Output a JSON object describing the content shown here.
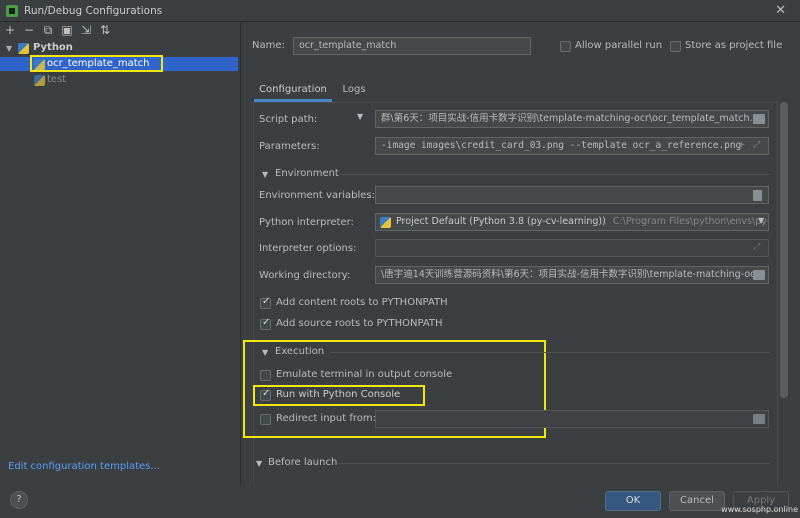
{
  "window": {
    "title": "Run/Debug Configurations"
  },
  "toolbar": {
    "icons": [
      "plus-icon",
      "minus-icon",
      "copy-icon",
      "save-icon",
      "move-icon",
      "sort-icon"
    ]
  },
  "tree": {
    "group_label": "Python",
    "items": [
      {
        "label": "ocr_template_match"
      },
      {
        "label": "test"
      }
    ]
  },
  "edit_templates_link": "Edit configuration templates...",
  "name_row": {
    "label": "Name:",
    "value": "ocr_template_match",
    "allow_parallel_label": "Allow parallel run",
    "store_project_label": "Store as project file"
  },
  "tabs": [
    "Configuration",
    "Logs"
  ],
  "config": {
    "script_path_label": "Script path:",
    "script_path_value": "群\\第6天：项目实战-信用卡数字识别\\template-matching-ocr\\ocr_template_match.py",
    "parameters_label": "Parameters:",
    "parameters_value": "-image images\\credit_card_03.png --template ocr_a_reference.png",
    "environment_section": "Environment",
    "env_vars_label": "Environment variables:",
    "env_vars_value": "",
    "interpreter_label": "Python interpreter:",
    "interpreter_value": "Project Default (Python 3.8 (py-cv-learning))",
    "interpreter_path": "C:\\Program Files\\python\\envs\\py-cv-le",
    "interpreter_options_label": "Interpreter options:",
    "interpreter_options_value": "",
    "working_dir_label": "Working directory:",
    "working_dir_value": "\\唐宇迪14天训练营源码资料\\第6天：项目实战-信用卡数字识别\\template-matching-ocr",
    "add_content_roots_label": "Add content roots to PYTHONPATH",
    "add_content_roots_checked": true,
    "add_source_roots_label": "Add source roots to PYTHONPATH",
    "add_source_roots_checked": true,
    "execution_section": "Execution",
    "emulate_terminal_label": "Emulate terminal in output console",
    "emulate_terminal_checked": false,
    "run_python_console_label": "Run with Python Console",
    "run_python_console_checked": true,
    "redirect_input_label": "Redirect input from:",
    "redirect_input_checked": false,
    "redirect_input_value": "",
    "before_launch_section": "Before launch"
  },
  "buttons": {
    "help": "?",
    "ok": "OK",
    "cancel": "Cancel",
    "apply": "Apply"
  },
  "watermark": "www.sosphp.online",
  "colors": {
    "highlight": "#f2e60f",
    "selection": "#2f65ca",
    "link": "#589df6",
    "primary_button": "#365880"
  }
}
